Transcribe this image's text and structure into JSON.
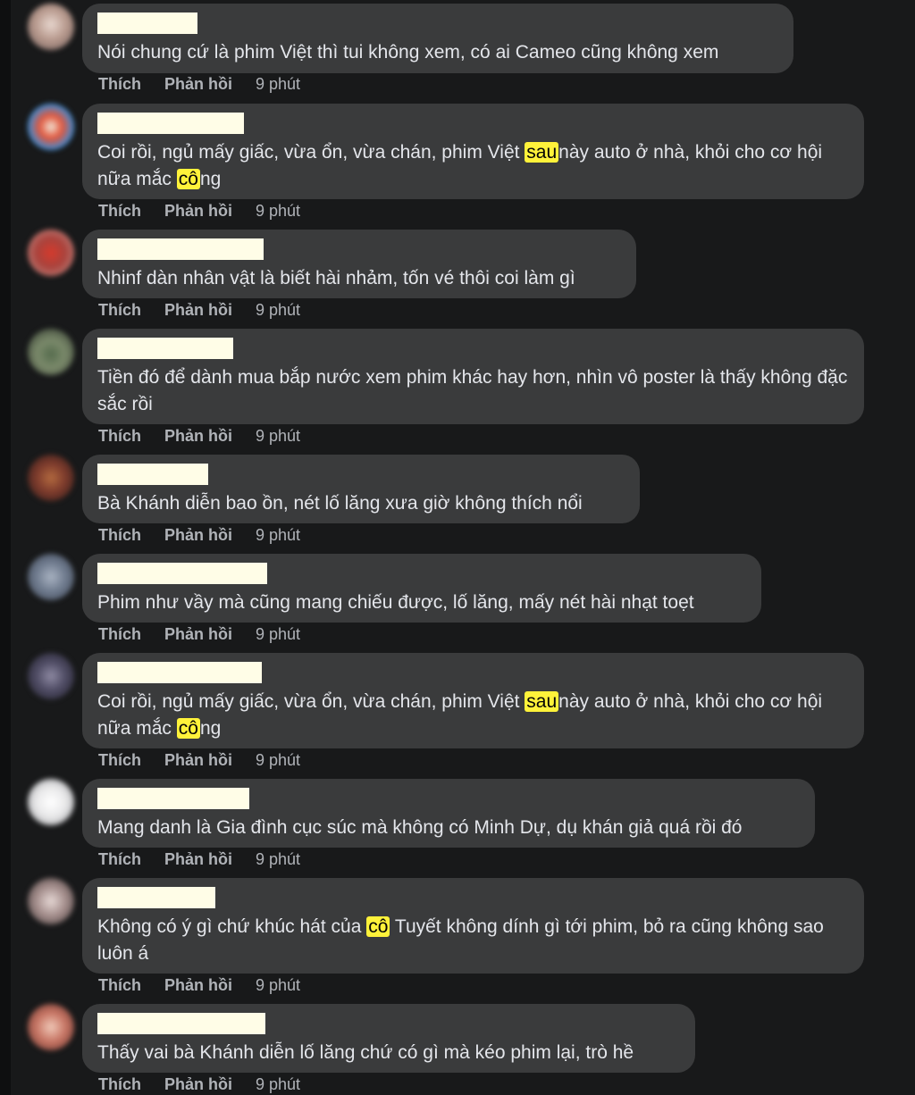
{
  "actions": {
    "like": "Thích",
    "reply": "Phản hồi",
    "time": "9 phút"
  },
  "comments": [
    {
      "text": "Nói chung cứ là phim Việt thì tui không xem, có ai Cameo cũng không xem"
    },
    {
      "part1": "Coi rồi, ngủ mấy giấc, vừa ổn, vừa chán, phim Việt ",
      "hl1": "sau",
      "part2": "này auto ở nhà, khỏi cho cơ hội nữa mắc ",
      "hl2": "cô",
      "part3": "ng"
    },
    {
      "text": "Nhinf dàn nhân vật là biết hài nhảm, tốn vé thôi coi làm gì"
    },
    {
      "text": "Tiền đó để dành mua bắp nước xem phim khác hay hơn, nhìn vô poster là thấy không đặc sắc rồi"
    },
    {
      "text": "Bà Khánh diễn bao ồn, nét lố lăng xưa giờ không thích nổi"
    },
    {
      "text": "Phim như vầy mà cũng mang chiếu được, lố lăng, mấy nét hài nhạt toẹt"
    },
    {
      "part1": "Coi rồi, ngủ mấy giấc, vừa ổn, vừa chán, phim Việt ",
      "hl1": "sau",
      "part2": "này auto ở nhà, khỏi cho cơ hội nữa mắc ",
      "hl2": "cô",
      "part3": "ng"
    },
    {
      "text": "Mang danh là Gia đình cục súc mà không có Minh Dự, dụ khán giả quá rồi đó"
    },
    {
      "part1": "Không có ý gì chứ khúc hát của ",
      "hl1": "cô",
      "part2": " Tuyết không dính gì tới phim, bỏ ra cũng không sao luôn á"
    },
    {
      "text": "Thấy vai bà Khánh diễn lố lăng chứ có gì mà kéo phim lại, trò hề"
    }
  ]
}
